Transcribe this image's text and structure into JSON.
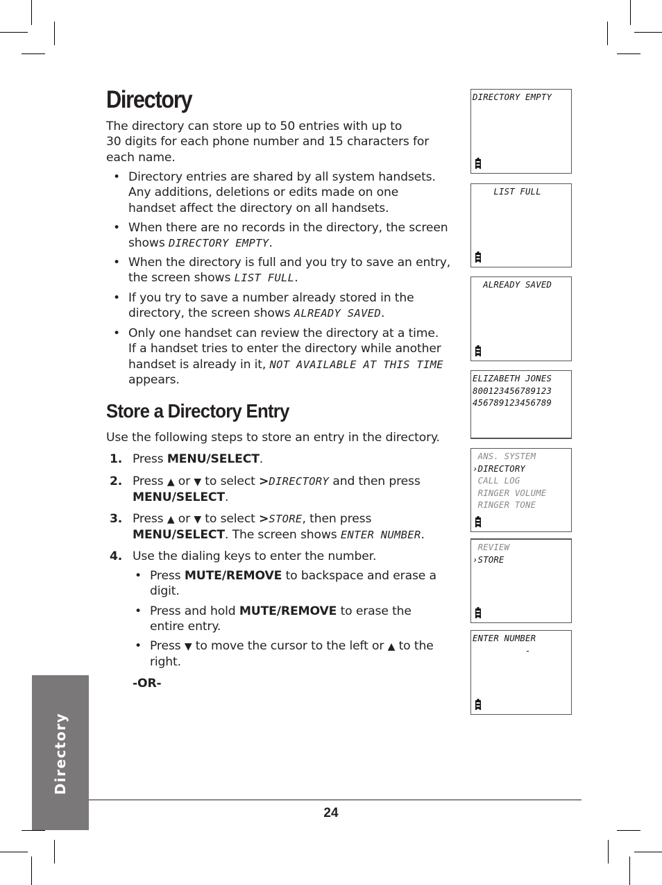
{
  "page": {
    "title": "Directory",
    "intro": "The directory can store up to 50 entries with up to 30 digits for each phone number and 15 characters for each name.",
    "intro_lines": [
      "The directory can store up to 50 entries with up to",
      "30 digits for each phone number and 15 characters for",
      "each name."
    ],
    "bullets": [
      {
        "lines": [
          "Directory entries are shared by all system handsets.",
          "Any additions, deletions or edits made on one",
          "handset affect the directory on all handsets."
        ]
      },
      {
        "pre": "When there are no records in the directory, the screen",
        "pre2": "shows ",
        "lcd": "DIRECTORY EMPTY",
        "post": "."
      },
      {
        "pre": "When the directory is full and you try to save an entry,",
        "pre2": "the screen shows ",
        "lcd": "LIST FULL",
        "post": "."
      },
      {
        "pre": "If you try to save a number already stored in the",
        "pre2": "directory, the screen shows ",
        "lcd": "ALREADY SAVED",
        "post": "."
      },
      {
        "pre": "Only one handset can review the directory at a time.",
        "pre_b": "If a handset tries to enter the directory while another",
        "pre2": "handset is already in it, ",
        "lcd": "NOT AVAILABLE AT THIS TIME",
        "post": "appears."
      }
    ],
    "section_title": "Store a Directory Entry",
    "section_intro": "Use the following steps to store an entry in the directory.",
    "steps": [
      {
        "num": "1.",
        "t1": "Press ",
        "b1": "MENU/SELECT",
        "t2": "."
      },
      {
        "num": "2.",
        "t1": "Press ",
        "up": "▲",
        "or": " or ",
        "down": "▼",
        "t2": "  to select ",
        "b_gt": ">",
        "lcd": "DIRECTORY",
        "t3": " and then press",
        "b2": "MENU/SELECT",
        "t4": "."
      },
      {
        "num": "3.",
        "t1": "Press ",
        "up": "▲",
        "or": " or ",
        "down": "▼",
        "t2": " to select ",
        "b_gt": ">",
        "lcd": "STORE",
        "t3": ", then press",
        "b2": "MENU/SELECT",
        "t4": ". The screen shows ",
        "lcd2": "ENTER NUMBER",
        "t5": "."
      },
      {
        "num": "4.",
        "t1": "Use the dialing keys to enter the number."
      }
    ],
    "sub_bullets": [
      {
        "t1": "Press ",
        "b1": "MUTE/REMOVE",
        "t2": " to backspace and erase a",
        "t3": "digit."
      },
      {
        "t1": "Press and hold ",
        "b1": "MUTE/REMOVE",
        "t2": " to erase the",
        "t3": "entire entry."
      },
      {
        "t1": "Press ",
        "down": "▼",
        "t2": " to move the cursor to the left or ",
        "up": "▲",
        "t2b": " to the",
        "t3": "right."
      }
    ],
    "or_label": "-OR-",
    "side_tab": "Directory",
    "page_number": "24"
  },
  "screens": [
    {
      "name": "directory-empty",
      "lines": [
        {
          "text": "DIRECTORY EMPTY",
          "dim": false
        }
      ],
      "battery": true
    },
    {
      "name": "list-full",
      "lines": [
        {
          "text": "    LIST FULL",
          "dim": false
        }
      ],
      "battery": true
    },
    {
      "name": "already-saved",
      "lines": [
        {
          "text": "  ALREADY SAVED",
          "dim": false
        }
      ],
      "battery": true
    },
    {
      "name": "entry-elizabeth-jones",
      "lines": [
        {
          "text": "ELIZABETH JONES",
          "dim": false
        },
        {
          "text": "800123456789123",
          "dim": false
        },
        {
          "text": "456789123456789",
          "dim": false
        }
      ],
      "battery": false
    },
    {
      "name": "main-menu",
      "lines": [
        {
          "text": " ANS. SYSTEM",
          "dim": true
        },
        {
          "text": "›DIRECTORY",
          "dim": false
        },
        {
          "text": " CALL LOG",
          "dim": true
        },
        {
          "text": " RINGER VOLUME",
          "dim": true
        },
        {
          "text": " RINGER TONE",
          "dim": true
        }
      ],
      "battery": true
    },
    {
      "name": "directory-menu",
      "lines": [
        {
          "text": " REVIEW",
          "dim": true
        },
        {
          "text": "›STORE",
          "dim": false
        }
      ],
      "battery": true
    },
    {
      "name": "enter-number",
      "lines": [
        {
          "text": "ENTER NUMBER",
          "dim": false
        },
        {
          "text": "",
          "dim": false
        },
        {
          "text": "",
          "dim": false
        },
        {
          "text": "          -",
          "dim": false
        }
      ],
      "battery": true
    }
  ]
}
